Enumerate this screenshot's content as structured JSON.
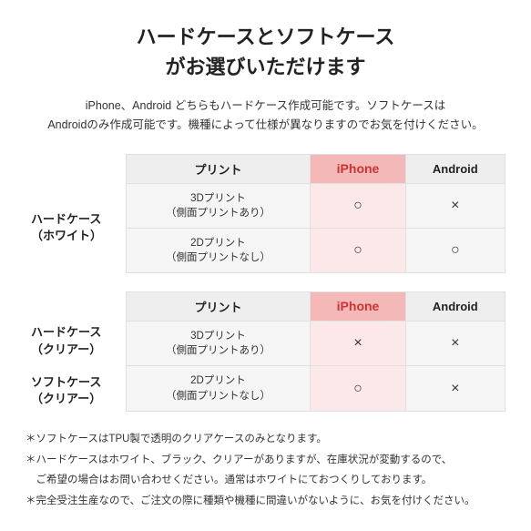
{
  "title": {
    "line1": "ハードケースとソフトケース",
    "line2": "がお選びいただけます"
  },
  "subtitle": "iPhone、Android どちらもハードケース作成可能です。ソフトケースは\nAndroidのみ作成可能です。機種によって仕様が異なりますのでお気を付けください。",
  "table1": {
    "row_header": "ハードケース\n（ホワイト）",
    "col_print": "プリント",
    "col_iphone": "iPhone",
    "col_android": "Android",
    "rows": [
      {
        "label": "3Dプリント\n（側面プリントあり）",
        "iphone": "○",
        "android": "×"
      },
      {
        "label": "2Dプリント\n（側面プリントなし）",
        "iphone": "○",
        "android": "○"
      }
    ]
  },
  "table2": {
    "row_header1": "ハードケース\n（クリアー）",
    "row_header2": "ソフトケース\n（クリアー）",
    "col_print": "プリント",
    "col_iphone": "iPhone",
    "col_android": "Android",
    "rows": [
      {
        "label": "3Dプリント\n（側面プリントあり）",
        "iphone": "×",
        "android": "×"
      },
      {
        "label": "2Dプリント\n（側面プリントなし）",
        "iphone": "○",
        "android": "×"
      }
    ]
  },
  "notes": [
    "＊ソフトケースはTPU製で透明のクリアケースのみとなります。",
    "＊ハードケースはホワイト、ブラック、クリアーがありますが、在庫状況が変動するので、",
    "　ご希望の場合はお問い合わせください。通常はホワイトにておつくりしております。",
    "＊完全受注生産なので、ご注文の際に種類や機種に間違いがないように、お気を付けください。"
  ]
}
